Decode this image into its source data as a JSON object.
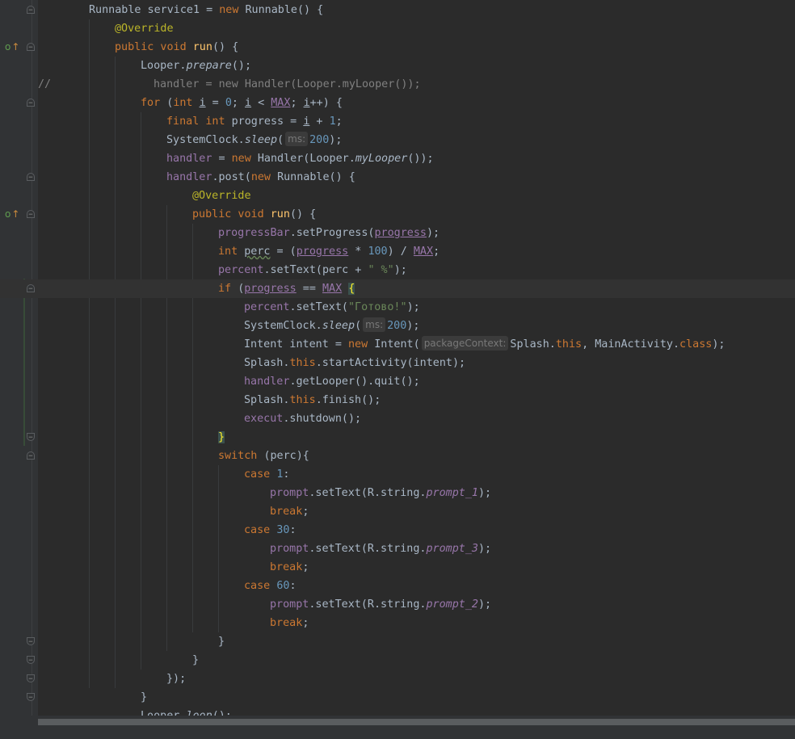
{
  "editor": {
    "lines": [
      {
        "parts": [
          [
            "",
            "Runnable service1 = "
          ],
          [
            "kw",
            "new "
          ],
          [
            "",
            "Runnable() {"
          ]
        ]
      },
      {
        "parts": [
          [
            "ann",
            "@Override"
          ]
        ]
      },
      {
        "parts": [
          [
            "kw",
            "public void "
          ],
          [
            "fn",
            "run"
          ],
          [
            "",
            "() {"
          ]
        ]
      },
      {
        "parts": [
          [
            "",
            "Looper."
          ],
          [
            "st-i",
            "prepare"
          ],
          [
            "",
            "();"
          ]
        ]
      },
      {
        "parts": [
          [
            "cmt",
            "handler = new Handler(Looper.myLooper());"
          ]
        ]
      },
      {
        "parts": [
          [
            "kw",
            "for "
          ],
          [
            "",
            "("
          ],
          [
            "kw",
            "int "
          ],
          [
            "ul",
            "i"
          ],
          [
            "",
            ""
          ],
          [
            "",
            " = "
          ],
          [
            "num",
            "0"
          ],
          [
            "",
            "; "
          ],
          [
            "ul",
            "i"
          ],
          [
            "",
            " < "
          ],
          [
            "fld-ul",
            "MAX"
          ],
          [
            "",
            "; "
          ],
          [
            "ul",
            "i"
          ],
          [
            "",
            "++) {"
          ]
        ]
      },
      {
        "parts": [
          [
            "kw",
            "final int "
          ],
          [
            "",
            "progress = "
          ],
          [
            "ul",
            "i"
          ],
          [
            "",
            " + "
          ],
          [
            "num",
            "1"
          ],
          [
            "",
            ";"
          ]
        ]
      },
      {
        "parts": [
          [
            "",
            "SystemClock."
          ],
          [
            "st-i",
            "sleep"
          ],
          [
            "",
            "("
          ],
          [
            "hint",
            "ms:"
          ],
          [
            "num",
            "200"
          ],
          [
            "",
            ");"
          ]
        ]
      },
      {
        "parts": [
          [
            "fld",
            "handler"
          ],
          [
            "",
            " = "
          ],
          [
            "kw",
            "new "
          ],
          [
            "",
            "Handler(Looper."
          ],
          [
            "st-i",
            "myLooper"
          ],
          [
            "",
            "());"
          ]
        ]
      },
      {
        "parts": [
          [
            "fld",
            "handler"
          ],
          [
            "",
            ".post("
          ],
          [
            "kw",
            "new "
          ],
          [
            "",
            "Runnable() {"
          ]
        ]
      },
      {
        "parts": [
          [
            "ann",
            "@Override"
          ]
        ]
      },
      {
        "parts": [
          [
            "kw",
            "public void "
          ],
          [
            "fn",
            "run"
          ],
          [
            "",
            "() {"
          ]
        ]
      },
      {
        "parts": [
          [
            "fld",
            "progressBar"
          ],
          [
            "",
            ".setProgress("
          ],
          [
            "fld-ul",
            "progress"
          ],
          [
            "",
            ");"
          ]
        ]
      },
      {
        "parts": [
          [
            "kw",
            "int "
          ],
          [
            "squig",
            "perc"
          ],
          [
            "",
            " = ("
          ],
          [
            "fld-ul",
            "progress"
          ],
          [
            "",
            " * "
          ],
          [
            "num",
            "100"
          ],
          [
            "",
            ") / "
          ],
          [
            "fld-ul",
            "MAX"
          ],
          [
            "",
            ";"
          ]
        ]
      },
      {
        "parts": [
          [
            "fld",
            "percent"
          ],
          [
            "",
            ".setText(perc + "
          ],
          [
            "str",
            "\" %\""
          ],
          [
            "",
            ");"
          ]
        ]
      },
      {
        "parts": [
          [
            "kw",
            "if "
          ],
          [
            "",
            "("
          ],
          [
            "fld-ul",
            "progress"
          ],
          [
            "",
            " == "
          ],
          [
            "fld-ul",
            "MAX"
          ],
          [
            "",
            " "
          ],
          [
            "brace-hl",
            "{"
          ]
        ]
      },
      {
        "parts": [
          [
            "fld",
            "percent"
          ],
          [
            "",
            ".setText("
          ],
          [
            "str",
            "\"Готово!\""
          ],
          [
            "",
            ");"
          ]
        ]
      },
      {
        "parts": [
          [
            "",
            "SystemClock."
          ],
          [
            "st-i",
            "sleep"
          ],
          [
            "",
            "("
          ],
          [
            "hint",
            "ms:"
          ],
          [
            "num",
            "200"
          ],
          [
            "",
            ");"
          ]
        ]
      },
      {
        "parts": [
          [
            "",
            "Intent intent = "
          ],
          [
            "kw",
            "new "
          ],
          [
            "",
            "Intent("
          ],
          [
            "hint",
            "packageContext:"
          ],
          [
            "",
            "Splash."
          ],
          [
            "kw",
            "this"
          ],
          [
            "",
            ", MainActivity."
          ],
          [
            "kw",
            "class"
          ],
          [
            "",
            ");"
          ]
        ]
      },
      {
        "parts": [
          [
            "",
            "Splash."
          ],
          [
            "kw",
            "this"
          ],
          [
            "",
            ".startActivity(intent);"
          ]
        ]
      },
      {
        "parts": [
          [
            "fld",
            "handler"
          ],
          [
            "",
            ".getLooper().quit();"
          ]
        ]
      },
      {
        "parts": [
          [
            "",
            "Splash."
          ],
          [
            "kw",
            "this"
          ],
          [
            "",
            ".finish();"
          ]
        ]
      },
      {
        "parts": [
          [
            "fld",
            "execut"
          ],
          [
            "",
            ".shutdown();"
          ]
        ]
      },
      {
        "parts": [
          [
            "brace-hl",
            "}"
          ]
        ]
      },
      {
        "parts": [
          [
            "kw",
            "switch "
          ],
          [
            "",
            "(perc){"
          ]
        ]
      },
      {
        "parts": [
          [
            "kw",
            "case "
          ],
          [
            "num",
            "1"
          ],
          [
            "",
            ":"
          ]
        ]
      },
      {
        "parts": [
          [
            "fld",
            "prompt"
          ],
          [
            "",
            ".setText(R.string."
          ],
          [
            "fld-i",
            "prompt_1"
          ],
          [
            "",
            ");"
          ]
        ]
      },
      {
        "parts": [
          [
            "kw",
            "break"
          ],
          [
            "",
            ";"
          ]
        ]
      },
      {
        "parts": [
          [
            "kw",
            "case "
          ],
          [
            "num",
            "30"
          ],
          [
            "",
            ":"
          ]
        ]
      },
      {
        "parts": [
          [
            "fld",
            "prompt"
          ],
          [
            "",
            ".setText(R.string."
          ],
          [
            "fld-i",
            "prompt_3"
          ],
          [
            "",
            ");"
          ]
        ]
      },
      {
        "parts": [
          [
            "kw",
            "break"
          ],
          [
            "",
            ";"
          ]
        ]
      },
      {
        "parts": [
          [
            "kw",
            "case "
          ],
          [
            "num",
            "60"
          ],
          [
            "",
            ":"
          ]
        ]
      },
      {
        "parts": [
          [
            "fld",
            "prompt"
          ],
          [
            "",
            ".setText(R.string."
          ],
          [
            "fld-i",
            "prompt_2"
          ],
          [
            "",
            ");"
          ]
        ]
      },
      {
        "parts": [
          [
            "kw",
            "break"
          ],
          [
            "",
            ";"
          ]
        ]
      },
      {
        "parts": [
          [
            "",
            "}"
          ]
        ]
      },
      {
        "parts": [
          [
            "",
            "}"
          ]
        ]
      },
      {
        "parts": [
          [
            "",
            "});"
          ]
        ]
      },
      {
        "parts": [
          [
            "",
            "}"
          ]
        ]
      },
      {
        "parts": [
          [
            "",
            "Looper."
          ],
          [
            "st-i",
            "loop"
          ],
          [
            "",
            "();"
          ]
        ]
      }
    ],
    "comment_prefix": "//",
    "override_marker": "o",
    "override_arrow": "↑"
  },
  "colors": {
    "background": "#2b2b2b",
    "keyword": "#cc7832",
    "annotation": "#bbb529",
    "number": "#6897bb",
    "string": "#6a8759",
    "field": "#9876aa",
    "method": "#ffc66d"
  }
}
